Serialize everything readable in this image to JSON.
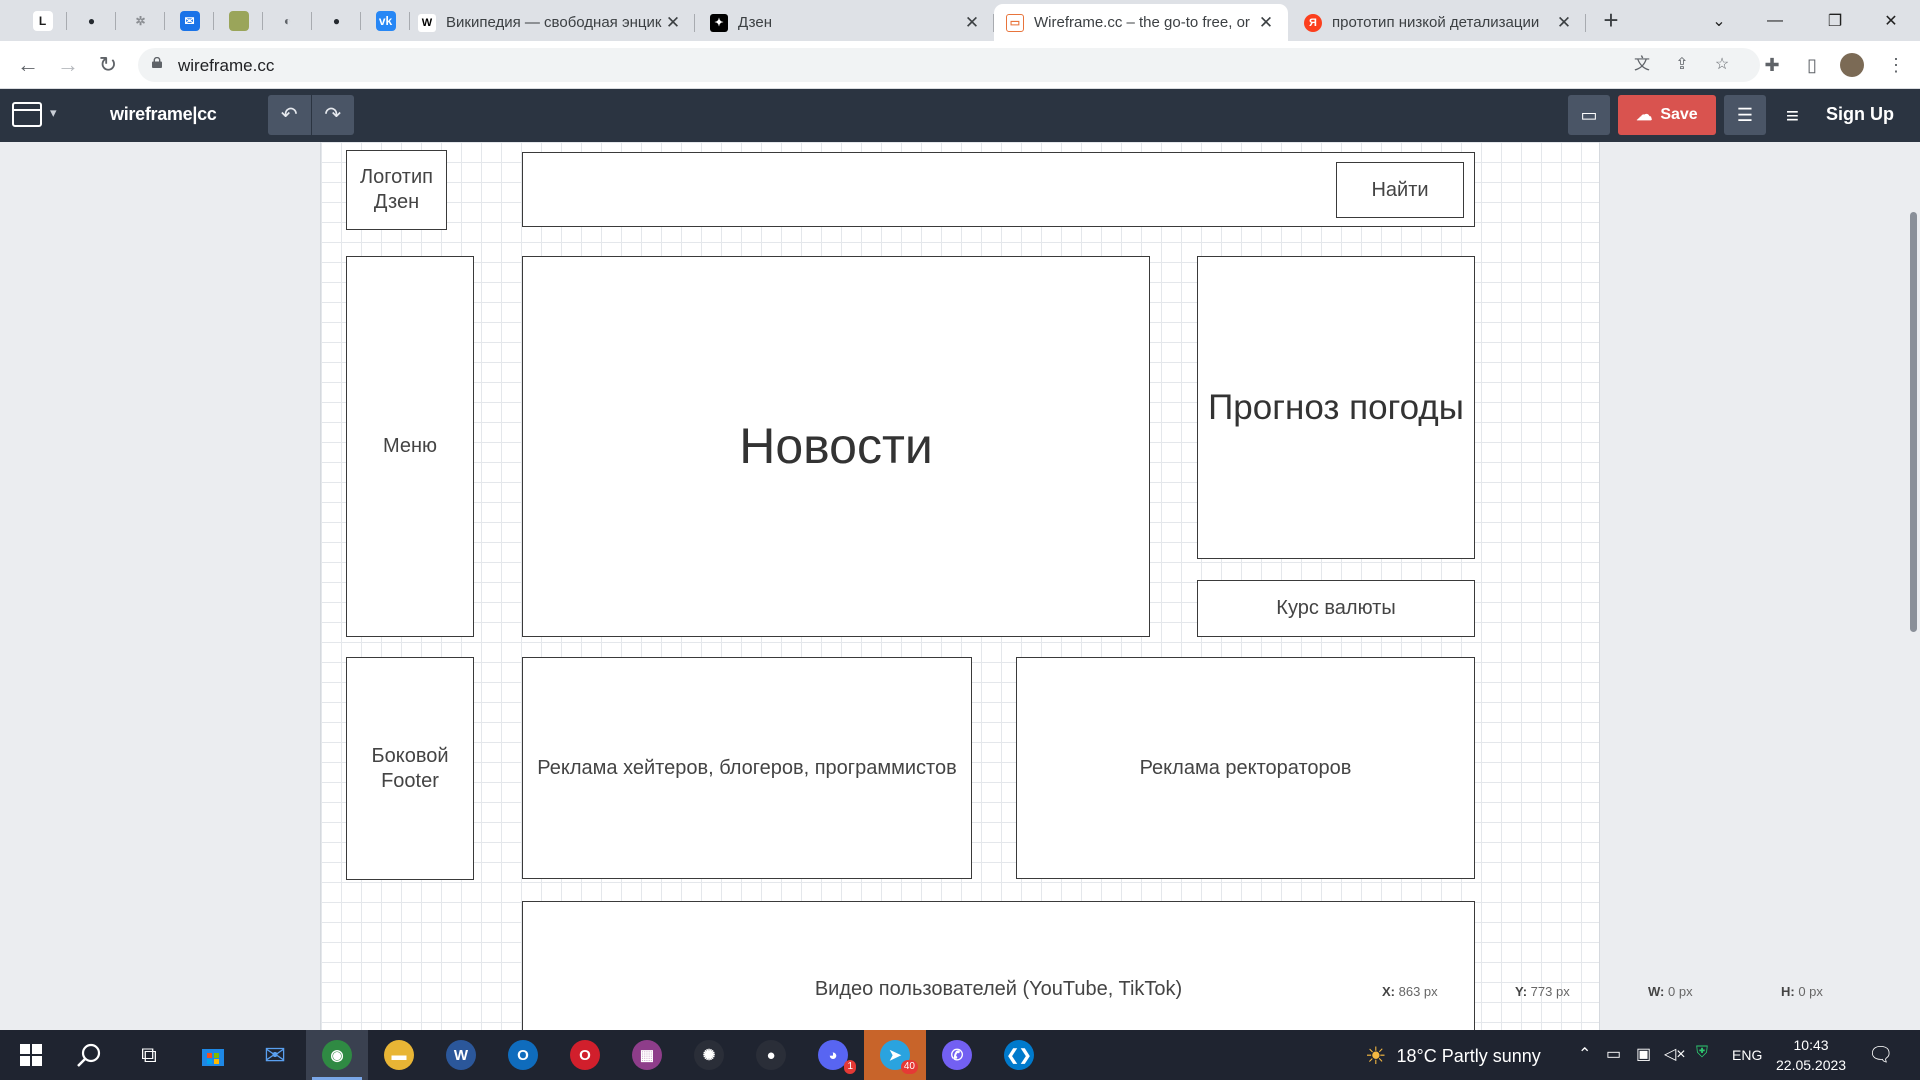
{
  "browser": {
    "pinned_tabs": [
      {
        "icon": "linear-icon",
        "glyph": "L",
        "color": "#ffffff",
        "fg": "#1c1c1c"
      },
      {
        "icon": "github-icon",
        "glyph": "●",
        "color": "#dee1e6",
        "fg": "#24292f"
      },
      {
        "icon": "extension-icon",
        "glyph": "✲",
        "color": "#dee1e6",
        "fg": "#8a8d92"
      },
      {
        "icon": "mail-icon",
        "glyph": "✉",
        "color": "#1a73e8",
        "fg": "#ffffff"
      },
      {
        "icon": "game-icon",
        "glyph": "●",
        "color": "#9aa55a",
        "fg": "#9aa55a"
      },
      {
        "icon": "globe-icon",
        "glyph": "◐",
        "color": "#dee1e6",
        "fg": "#5f6368"
      },
      {
        "icon": "github-icon",
        "glyph": "●",
        "color": "#dee1e6",
        "fg": "#24292f"
      },
      {
        "icon": "vk-icon",
        "glyph": "vk",
        "color": "#2787f5",
        "fg": "#ffffff"
      }
    ],
    "tabs": [
      {
        "title": "Википедия — свободная энцик",
        "favicon": "wikipedia-icon",
        "glyph": "W",
        "color": "#ffffff",
        "fg": "#000000"
      },
      {
        "title": "Дзен",
        "favicon": "dzen-icon",
        "glyph": "✦",
        "color": "#000000",
        "fg": "#ffffff"
      },
      {
        "title": "Wireframe.cc – the go-to free, or",
        "favicon": "wireframe-icon",
        "glyph": "▭",
        "color": "#ffffff",
        "fg": "#e8743b"
      },
      {
        "title": "прототип низкой детализации",
        "favicon": "yandex-icon",
        "glyph": "Я",
        "color": "#fc3f1d",
        "fg": "#ffffff"
      }
    ],
    "new_tab": "+",
    "url": "wireframe.cc"
  },
  "app": {
    "brand": "wireframe|cc",
    "save_label": "Save",
    "signup_label": "Sign Up"
  },
  "wireframe": {
    "logo": "Логотип Дзен",
    "search_button": "Найти",
    "menu": "Меню",
    "news": "Новости",
    "weather": "Прогноз погоды",
    "currency": "Курс валюты",
    "side_footer": "Боковой Footer",
    "ads_bloggers": "Реклама хейтеров, блогеров, программистов",
    "ads_rectors": "Реклама ректораторов",
    "user_video": "Видео пользователей (YouTube, TikTok)"
  },
  "status": {
    "x_label": "X:",
    "x_value": "863 px",
    "y_label": "Y:",
    "y_value": "773 px",
    "w_label": "W:",
    "w_value": "0 px",
    "h_label": "H:",
    "h_value": "0 px"
  },
  "taskbar": {
    "apps": [
      {
        "name": "chrome-icon",
        "color": "#2f8a43",
        "glyph": "◉"
      },
      {
        "name": "file-explorer-icon",
        "color": "#e8b535",
        "glyph": "▬"
      },
      {
        "name": "word-icon",
        "color": "#2b579a",
        "glyph": "W"
      },
      {
        "name": "outlook-icon",
        "color": "#0f6cbd",
        "glyph": "O"
      },
      {
        "name": "opera-icon",
        "color": "#d11f2c",
        "glyph": "O"
      },
      {
        "name": "winrar-icon",
        "color": "#8e3d8a",
        "glyph": "▦"
      },
      {
        "name": "openai-icon",
        "color": "#2a2e38",
        "glyph": "✺"
      },
      {
        "name": "github-desktop-icon",
        "color": "#2a2e38",
        "glyph": "●"
      },
      {
        "name": "discord-icon",
        "color": "#5865f2",
        "glyph": "◕"
      },
      {
        "name": "telegram-icon",
        "color": "#2aa3df",
        "glyph": "➤"
      },
      {
        "name": "viber-icon",
        "color": "#7360f2",
        "glyph": "✆"
      },
      {
        "name": "vscode-icon",
        "color": "#007acc",
        "glyph": "❮❯"
      }
    ],
    "telegram_badge": "40",
    "discord_badge": "1",
    "weather": "18°C Partly sunny",
    "language": "ENG",
    "time": "10:43",
    "date": "22.05.2023"
  }
}
